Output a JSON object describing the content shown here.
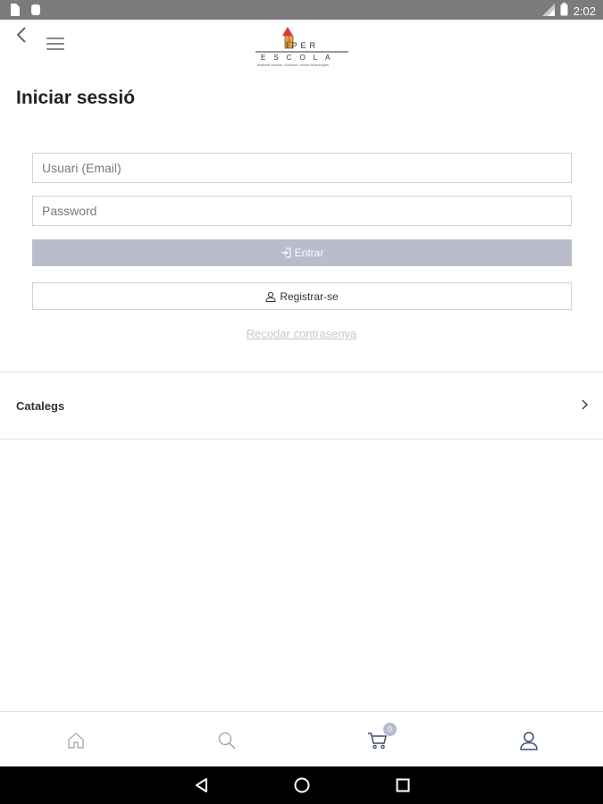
{
  "status_bar": {
    "time": "2:02",
    "icons": [
      "sim-icon",
      "android-icon",
      "signal-icon",
      "battery-icon"
    ]
  },
  "header": {
    "back_icon": "chevron-left-icon",
    "menu_icon": "hamburger-menu-icon",
    "logo": {
      "word1": "IPER",
      "word2": "ESCOLA",
      "tagline": "Material escolar, d'oficina i noves tecnologies"
    }
  },
  "page": {
    "title": "Iniciar sessió"
  },
  "login_form": {
    "email_placeholder": "Usuari (Email)",
    "email_value": "",
    "password_placeholder": "Password",
    "password_value": "",
    "login_label": "Entrar",
    "login_icon": "sign-in-icon",
    "register_label": "Registrar-se",
    "register_icon": "user-icon",
    "forgot_label": "Recodar contrasenya"
  },
  "menu": {
    "items": [
      {
        "label": "Catalegs",
        "icon": "chevron-right-icon"
      }
    ]
  },
  "bottom_nav": {
    "items": [
      {
        "name": "home",
        "icon": "home-icon"
      },
      {
        "name": "search",
        "icon": "search-icon"
      },
      {
        "name": "cart",
        "icon": "cart-icon",
        "badge": "0"
      },
      {
        "name": "account",
        "icon": "user-icon"
      }
    ]
  },
  "colors": {
    "status_bar": "#7b7b7b",
    "login_button": "#b9bccb",
    "link": "#c5c7d0",
    "accent": "#3d4a7a",
    "logo_red": "#e23b2a",
    "logo_orange": "#e8a04a"
  }
}
